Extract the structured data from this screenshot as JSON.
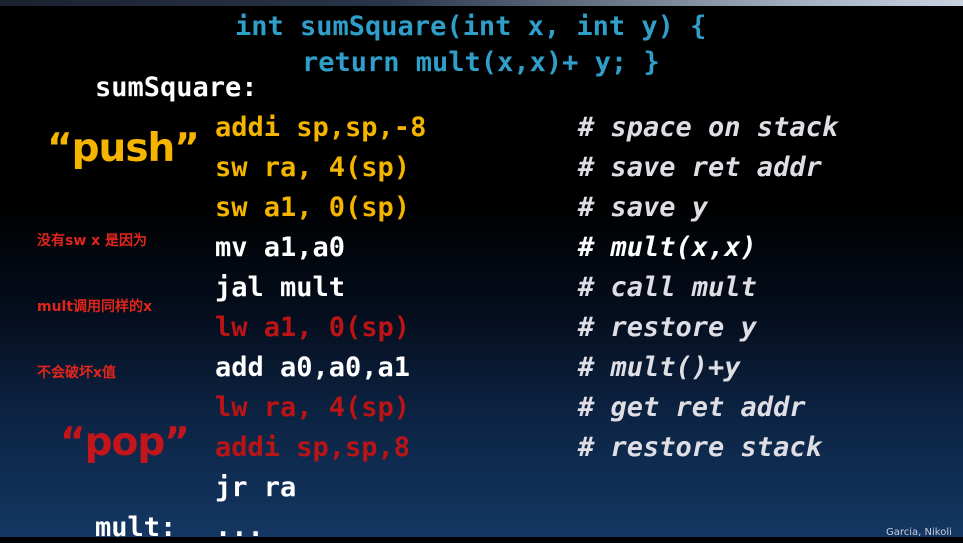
{
  "header": {
    "signature_line": "int sumSquare(int x, int y) {",
    "return_line": "return mult(x,x)+ y; }"
  },
  "labels": {
    "sumsquare": "sumSquare:",
    "mult": "mult:",
    "mult_body": "...",
    "push": "“push”",
    "pop": "“pop”"
  },
  "note": {
    "line1": "没有sw x 是因为",
    "line2": "mult调用同样的x",
    "line3": "不会破坏x值"
  },
  "instructions": [
    {
      "code": "addi sp,sp,-8",
      "comment": "# space on stack",
      "color": "#f4b400"
    },
    {
      "code": "sw ra, 4(sp)",
      "comment": "# save ret addr",
      "color": "#f4b400"
    },
    {
      "code": "sw a1, 0(sp)",
      "comment": "# save y",
      "color": "#f4b400"
    },
    {
      "code": "mv a1,a0",
      "comment": "# mult(x,x)",
      "color": "#ffffff"
    },
    {
      "code": "jal mult",
      "comment": "# call mult",
      "color": "#ffffff"
    },
    {
      "code": "lw a1, 0(sp)",
      "comment": "# restore y",
      "color": "#bb1414"
    },
    {
      "code": "add a0,a0,a1",
      "comment": "# mult()+y",
      "color": "#ffffff"
    },
    {
      "code": "lw ra, 4(sp)",
      "comment": "# get ret addr",
      "color": "#bb1414"
    },
    {
      "code": "addi sp,sp,8",
      "comment": "# restore stack",
      "color": "#bb1414"
    },
    {
      "code": "jr ra",
      "comment": "",
      "color": "#ffffff"
    }
  ],
  "footer": {
    "author": "Garcia, Nikoli"
  }
}
